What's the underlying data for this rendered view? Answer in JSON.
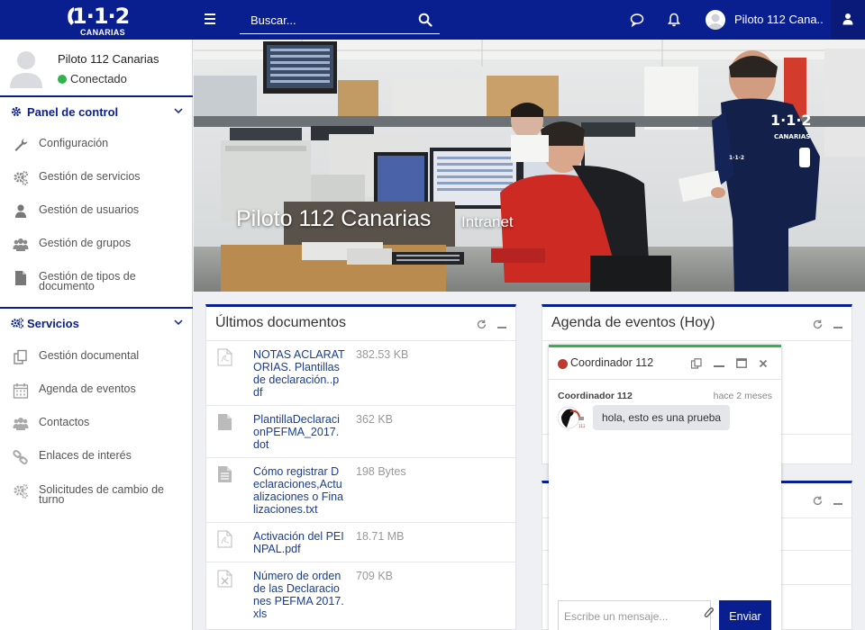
{
  "logo": {
    "main": "1·1·2",
    "sub": "CANARIAS"
  },
  "header": {
    "search_placeholder": "Buscar...",
    "user_name": "Piloto 112 Cana..."
  },
  "profile": {
    "name": "Piloto 112 Canarias",
    "status": "Conectado"
  },
  "sidebar": {
    "panel": {
      "label": "Panel de control",
      "items": [
        {
          "label": "Configuración",
          "icon": "wrench-icon"
        },
        {
          "label": "Gestión de servicios",
          "icon": "gears-icon"
        },
        {
          "label": "Gestión de usuarios",
          "icon": "user-icon"
        },
        {
          "label": "Gestión de grupos",
          "icon": "group-icon"
        },
        {
          "label": "Gestión de tipos de documento",
          "icon": "document-icon"
        }
      ]
    },
    "services": {
      "label": "Servicios",
      "items": [
        {
          "label": "Gestión documental",
          "icon": "copy-icon"
        },
        {
          "label": "Agenda de eventos",
          "icon": "calendar-icon"
        },
        {
          "label": "Contactos",
          "icon": "contacts-icon"
        },
        {
          "label": "Enlaces de interés",
          "icon": "link-icon"
        },
        {
          "label": "Solicitudes de cambio de turno",
          "icon": "gears-icon"
        }
      ]
    }
  },
  "banner": {
    "title": "Piloto 112 Canarias",
    "subtitle": "Intranet"
  },
  "documents": {
    "title": "Últimos documentos",
    "items": [
      {
        "name": "NOTAS ACLARATORIAS. Plantillas de declaración..pdf",
        "size": "382.53 KB",
        "type": "pdf"
      },
      {
        "name": "PlantillaDeclaracionPEFMA_2017.dot",
        "size": "362 KB",
        "type": "doc"
      },
      {
        "name": "Cómo registrar Declaraciones,Actualizaciones o Finalizaciones.txt",
        "size": "198 Bytes",
        "type": "txt"
      },
      {
        "name": "Activación del PEINPAL.pdf",
        "size": "18.71 MB",
        "type": "pdf"
      },
      {
        "name": "Número de orden de las Declaraciones PEFMA 2017.xls",
        "size": "709 KB",
        "type": "xls"
      }
    ]
  },
  "agenda": {
    "title": "Agenda de eventos (Hoy)"
  },
  "chat": {
    "title": "Coordinador 112",
    "messages": [
      {
        "author": "Coordinador 112",
        "time": "hace 2 meses",
        "text": "hola, esto es una prueba"
      }
    ],
    "input_placeholder": "Escribe un mensaje...",
    "send_label": "Enviar"
  },
  "colors": {
    "primary": "#0a1f8f",
    "online": "#2fb34a",
    "busy": "#c0392b",
    "link": "#1a3d8f"
  }
}
